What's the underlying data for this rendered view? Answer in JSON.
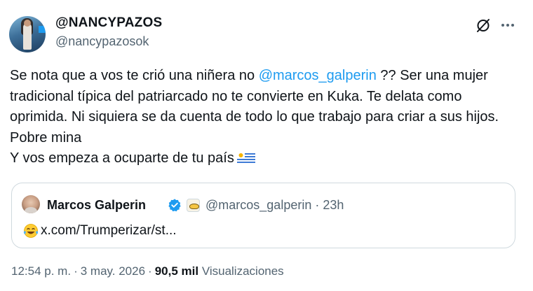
{
  "author": {
    "display_name": "@NANCYPAZOS",
    "handle": "@nancypazosok"
  },
  "tweet": {
    "text_part1": "Se nota que a vos te crió una niñera no ",
    "mention": "@marcos_galperin",
    "text_part2": " ?? Ser una mujer tradicional típica del patriarcado no te convierte en Kuka. Te delata como oprimida. Ni siquiera se da cuenta de todo lo que trabajo para criar a sus hijos. Pobre mina\nY vos empeza a ocuparte de tu país",
    "flag_icon": "uruguay-flag-icon"
  },
  "quote": {
    "name": "Marcos Galperin",
    "handle": "@marcos_galperin",
    "separator": "·",
    "time": "23h",
    "emoji_icon": "face-with-tears-of-joy-icon",
    "text": "x.com/Trumperizar/st..."
  },
  "footer": {
    "time": "12:54 p. m.",
    "separator": "·",
    "date": "3 may. 2026",
    "views_count": "90,5 mil",
    "views_label": "Visualizaciones"
  },
  "colors": {
    "link": "#1d9bf0",
    "secondary_text": "#536471",
    "border": "#cfd9de"
  }
}
